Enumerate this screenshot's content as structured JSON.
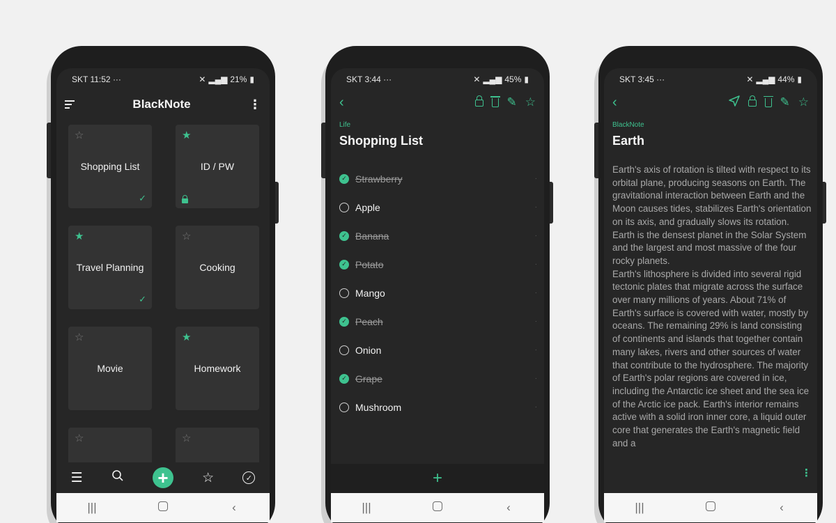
{
  "phone1": {
    "status": {
      "carrier_time": "SKT 11:52",
      "more": "···",
      "battery": "21%"
    },
    "header": {
      "title": "BlackNote"
    },
    "cards": [
      {
        "title": "Shopping List",
        "starred": false,
        "checked": true,
        "locked": false
      },
      {
        "title": "ID / PW",
        "starred": true,
        "checked": false,
        "locked": true
      },
      {
        "title": "Travel Planning",
        "starred": true,
        "checked": true,
        "locked": false
      },
      {
        "title": "Cooking",
        "starred": false,
        "checked": false,
        "locked": false
      },
      {
        "title": "Movie",
        "starred": false,
        "checked": false,
        "locked": false
      },
      {
        "title": "Homework",
        "starred": true,
        "checked": false,
        "locked": false
      },
      {
        "title": "",
        "starred": false,
        "checked": false,
        "locked": false
      },
      {
        "title": "",
        "starred": false,
        "checked": false,
        "locked": false
      }
    ],
    "bottombar": [
      "menu-icon",
      "search-icon",
      "add-icon",
      "star-icon",
      "check-circle-icon"
    ]
  },
  "phone2": {
    "status": {
      "carrier_time": "SKT 3:44",
      "more": "···",
      "battery": "45%"
    },
    "category": "Life",
    "title": "Shopping List",
    "items": [
      {
        "label": "Strawberry",
        "done": true
      },
      {
        "label": "Apple",
        "done": false
      },
      {
        "label": "Banana",
        "done": true
      },
      {
        "label": "Potato",
        "done": true
      },
      {
        "label": "Mango",
        "done": false
      },
      {
        "label": "Peach",
        "done": true
      },
      {
        "label": "Onion",
        "done": false
      },
      {
        "label": "Grape",
        "done": true
      },
      {
        "label": "Mushroom",
        "done": false
      }
    ],
    "add_icon": "+"
  },
  "phone3": {
    "status": {
      "carrier_time": "SKT 3:45",
      "more": "···",
      "battery": "44%"
    },
    "category": "BlackNote",
    "title": "Earth",
    "body": [
      "Earth's axis of rotation is tilted with respect to its orbital plane, producing seasons on Earth. The gravitational interaction between Earth and the Moon causes tides, stabilizes Earth's orientation on its axis, and gradually slows its rotation. Earth is the densest planet in the Solar System and the largest and most massive of the four rocky planets.",
      "Earth's lithosphere is divided into several rigid tectonic plates that migrate across the surface over many millions of years. About 71% of Earth's surface is covered with water, mostly by oceans. The remaining 29% is land consisting",
      "of continents and islands that together contain many lakes, rivers and other sources of water that contribute to the hydrosphere. The majority of Earth's polar regions are covered in ice, including the Antarctic ice sheet and the sea ice of the Arctic ice pack. Earth's interior remains active with a solid iron inner core, a liquid outer core that generates the Earth's magnetic field and a"
    ]
  },
  "colors": {
    "accent": "#3ec28f",
    "screen_bg": "#262626",
    "card_bg": "#333333"
  }
}
